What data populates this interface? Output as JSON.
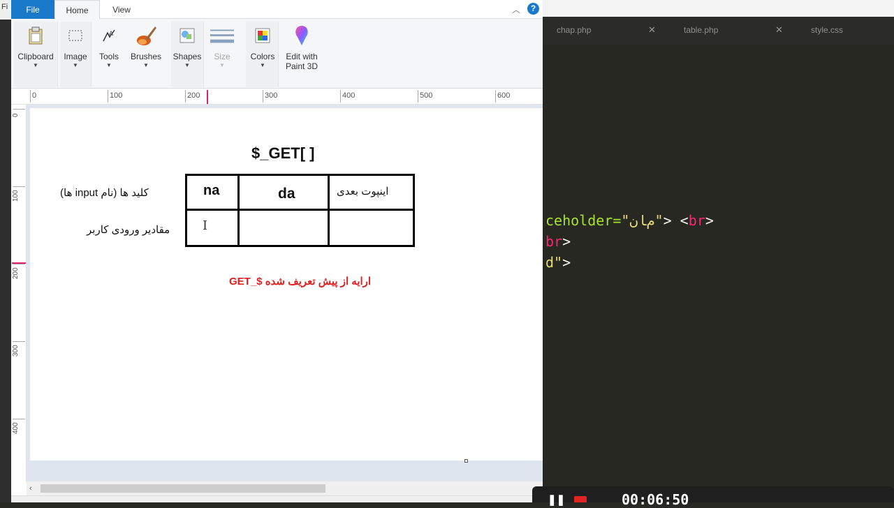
{
  "editor": {
    "tabs": [
      {
        "label": "chap.php"
      },
      {
        "label": "table.php"
      },
      {
        "label": "style.css"
      }
    ],
    "code_lines": [
      {
        "a": "ceholder=",
        "b": "\"ﻡﺎﻥ\"",
        "c": "> <",
        "d": "br",
        "e": ">"
      },
      {
        "a": "",
        "b": "",
        "c": "",
        "d": "br",
        "e": ">"
      },
      {
        "a": "d",
        "b": "\"",
        "c": ">",
        "d": "",
        "e": ""
      }
    ]
  },
  "left_strip": {
    "label": "Fi"
  },
  "paint": {
    "tabs": {
      "file": "File",
      "home": "Home",
      "view": "View"
    },
    "ribbon": [
      {
        "name": "clipboard",
        "label": "Clipboard",
        "icon": "clipboard-icon",
        "disabled": false
      },
      {
        "name": "image",
        "label": "Image",
        "icon": "select-icon",
        "disabled": false
      },
      {
        "name": "tools",
        "label": "Tools",
        "icon": "tools-icon",
        "disabled": false
      },
      {
        "name": "brushes",
        "label": "Brushes",
        "icon": "brush-icon",
        "disabled": false
      },
      {
        "name": "shapes",
        "label": "Shapes",
        "icon": "shapes-icon",
        "disabled": false
      },
      {
        "name": "size",
        "label": "Size",
        "icon": "size-icon",
        "disabled": true
      },
      {
        "name": "colors",
        "label": "Colors",
        "icon": "colors-icon",
        "disabled": false
      },
      {
        "name": "edit-paint3d",
        "label": "Edit with\nPaint 3D",
        "icon": "paint3d-icon",
        "disabled": false
      }
    ],
    "ruler_h": [
      "0",
      "100",
      "200",
      "300",
      "400",
      "500",
      "600"
    ],
    "ruler_v": [
      "0",
      "100",
      "200",
      "300",
      "400"
    ],
    "canvas": {
      "title": "$_GET[ ]",
      "row_labels": {
        "keys": "کلید ها (نام input ها)",
        "values": "مقادیر ورودی کاربر"
      },
      "cells": {
        "c1": "na",
        "c2": "da",
        "c3": "اینپوت بعدی"
      },
      "note": "ارایه از پیش تعریف شده $_GET"
    }
  },
  "recorder": {
    "time": "00:06:50"
  }
}
